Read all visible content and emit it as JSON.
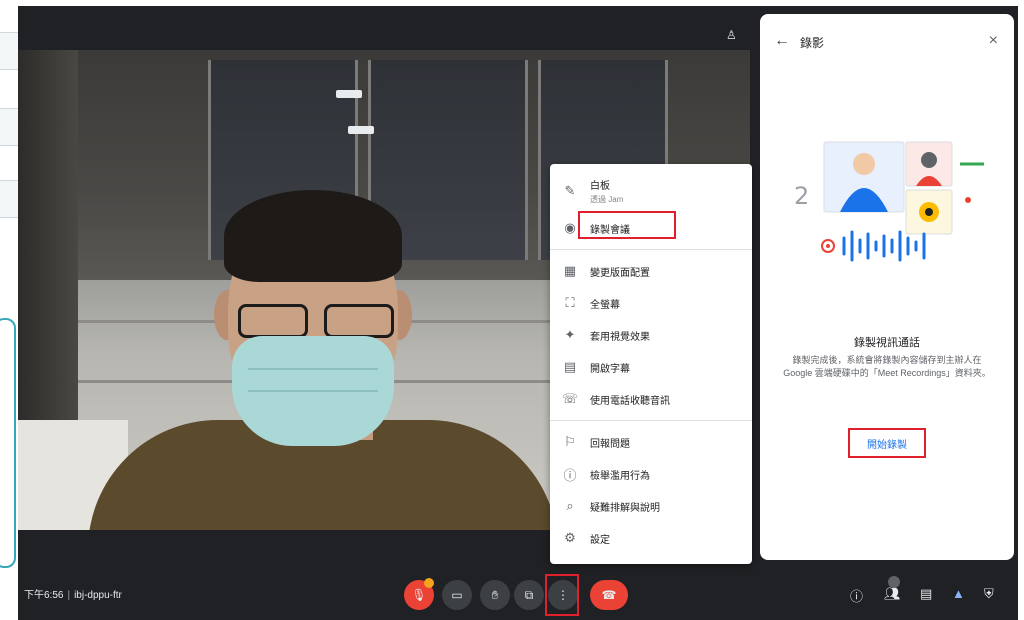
{
  "meeting": {
    "time": "下午6:56",
    "separator": "|",
    "code": "ibj-dppu-ftr"
  },
  "menu": {
    "items": [
      {
        "icon": "whiteboard-icon",
        "glyph": "✎",
        "label": "白板",
        "sub": "透過 Jam"
      },
      {
        "icon": "record-icon",
        "glyph": "◉",
        "label": "錄製會議"
      },
      {
        "icon": "layout-icon",
        "glyph": "▦",
        "label": "變更版面配置"
      },
      {
        "icon": "fullscreen-icon",
        "glyph": "⛶",
        "label": "全螢幕"
      },
      {
        "icon": "effects-icon",
        "glyph": "✦",
        "label": "套用視覺效果"
      },
      {
        "icon": "captions-icon",
        "glyph": "▤",
        "label": "開啟字幕"
      },
      {
        "icon": "phone-audio-icon",
        "glyph": "☏",
        "label": "使用電話收聽音訊"
      },
      {
        "icon": "feedback-icon",
        "glyph": "⚐",
        "label": "回報問題"
      },
      {
        "icon": "report-abuse-icon",
        "glyph": "ⓘ",
        "label": "檢舉濫用行為"
      },
      {
        "icon": "troubleshoot-icon",
        "glyph": "⌕",
        "label": "疑難排解與說明"
      },
      {
        "icon": "settings-icon",
        "glyph": "⚙",
        "label": "設定"
      }
    ]
  },
  "panel": {
    "title": "錄影",
    "back_glyph": "←",
    "close_glyph": "×",
    "heading": "錄製視訊通話",
    "description": "錄製完成後，系統會將錄製內容儲存到主辦人在 Google 雲端硬碟中的「Meet Recordings」資料夾。",
    "start_button": "開始錄製"
  },
  "colors": {
    "meet_bg": "#202124",
    "accent": "#1a73e8",
    "end_call": "#ea4335",
    "highlight": "#e0202a"
  }
}
